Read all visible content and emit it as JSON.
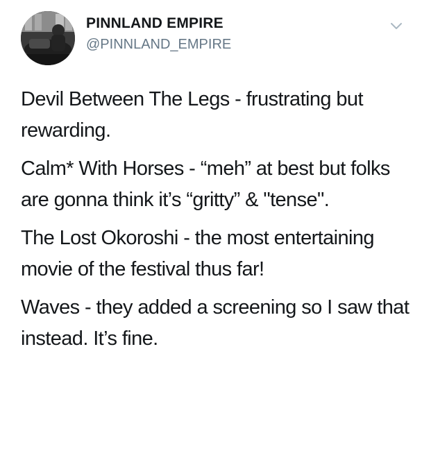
{
  "tweet": {
    "display_name": "PINNLAND EMPIRE",
    "handle": "@PINNLAND_EMPIRE",
    "avatar_icon": "profile-photo",
    "menu_icon": "chevron-down-icon",
    "paragraphs": [
      "Devil Between The Legs - frustrating but rewarding.",
      "Calm* With Horses - “meh” at best but folks are gonna think it’s “gritty” & \"tense\".",
      "The Lost Okoroshi - the most entertaining movie of the festival thus far!",
      "Waves - they added a screening so I saw that instead. It’s fine."
    ]
  },
  "colors": {
    "text_primary": "#14171a",
    "text_secondary": "#657786",
    "chevron": "#aab8c2"
  }
}
